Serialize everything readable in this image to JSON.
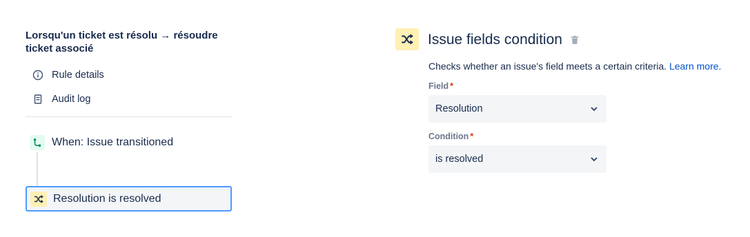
{
  "left_panel": {
    "rule_title": "Lorsqu'un ticket est résolu → résoudre ticket associé",
    "nav": [
      {
        "label": "Rule details",
        "icon": "info-icon"
      },
      {
        "label": "Audit log",
        "icon": "document-icon"
      }
    ],
    "trigger": {
      "label": "When: Issue transitioned",
      "icon": "transition-icon",
      "icon_bg": "#e3fcef",
      "icon_color": "#00875a"
    },
    "condition": {
      "label": "Resolution is resolved",
      "icon": "shuffle-icon",
      "icon_bg": "#fff0b3",
      "selected_border": "#4c9aff"
    }
  },
  "right_panel": {
    "title": "Issue fields condition",
    "description": "Checks whether an issue's field meets a certain criteria.",
    "learn_more": "Learn more.",
    "field": {
      "label": "Field",
      "required_mark": "*",
      "value": "Resolution"
    },
    "condition": {
      "label": "Condition",
      "required_mark": "*",
      "value": "is resolved"
    }
  }
}
